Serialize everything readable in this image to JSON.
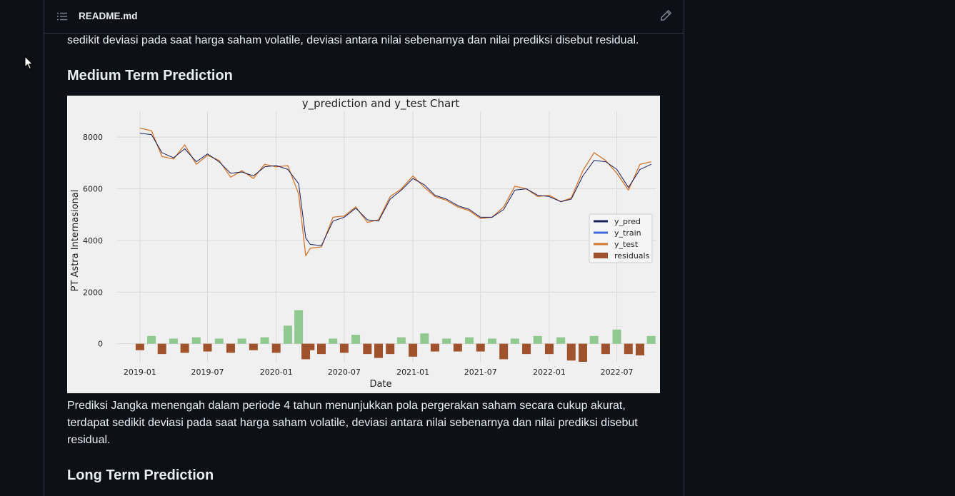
{
  "file": {
    "name": "README.md",
    "toc_icon": "list-unordered-icon",
    "edit_icon": "pencil-icon"
  },
  "content": {
    "top_paragraph": "sedikit deviasi pada saat harga saham volatile, deviasi antara nilai sebenarnya dan nilai prediksi disebut residual.",
    "medium_heading": "Medium Term Prediction",
    "bottom_paragraph": "Prediksi Jangka menengah dalam periode 4 tahun menunjukkan pola pergerakan saham secara cukup akurat, terdapat sedikit deviasi pada saat harga saham volatile, deviasi antara nilai sebenarnya dan nilai prediksi disebut residual.",
    "long_heading": "Long Term Prediction"
  },
  "colors": {
    "y_pred": "#1b1f5e",
    "y_train": "#4169e1",
    "y_test": "#d2772f",
    "residual_neg": "#a0522d",
    "residual_pos": "#8fc98f"
  },
  "chart_data": {
    "type": "line",
    "title": "y_prediction and y_test Chart",
    "xlabel": "Date",
    "ylabel": "PT Astra Internasional",
    "x_ticks": [
      "2019-01",
      "2019-07",
      "2020-01",
      "2020-07",
      "2021-01",
      "2021-07",
      "2022-01",
      "2022-07"
    ],
    "y_ticks": [
      0,
      2000,
      4000,
      6000,
      8000
    ],
    "ylim": [
      -700,
      9000
    ],
    "xlim": [
      "2018-11-01",
      "2022-10-15"
    ],
    "grid": true,
    "legend": {
      "placement": "center-right",
      "entries": [
        "y_pred",
        "y_train",
        "y_test",
        "residuals"
      ]
    },
    "series": [
      {
        "name": "y_test",
        "x": [
          "2019-01-01",
          "2019-02-01",
          "2019-03-01",
          "2019-04-01",
          "2019-05-01",
          "2019-06-01",
          "2019-07-01",
          "2019-08-01",
          "2019-09-01",
          "2019-10-01",
          "2019-11-01",
          "2019-12-01",
          "2020-01-01",
          "2020-02-01",
          "2020-03-01",
          "2020-03-20",
          "2020-04-01",
          "2020-05-01",
          "2020-06-01",
          "2020-07-01",
          "2020-08-01",
          "2020-09-01",
          "2020-10-01",
          "2020-11-01",
          "2020-12-01",
          "2021-01-01",
          "2021-02-01",
          "2021-03-01",
          "2021-04-01",
          "2021-05-01",
          "2021-06-01",
          "2021-07-01",
          "2021-08-01",
          "2021-09-01",
          "2021-10-01",
          "2021-11-01",
          "2021-12-01",
          "2022-01-01",
          "2022-02-01",
          "2022-03-01",
          "2022-04-01",
          "2022-05-01",
          "2022-06-01",
          "2022-07-01",
          "2022-08-01",
          "2022-09-01",
          "2022-10-01"
        ],
        "values": [
          8350,
          8250,
          7250,
          7150,
          7700,
          6950,
          7300,
          7100,
          6450,
          6700,
          6400,
          6950,
          6850,
          6900,
          5800,
          3400,
          3700,
          3750,
          4900,
          4950,
          5300,
          4700,
          4800,
          5700,
          6000,
          6500,
          6050,
          5700,
          5550,
          5300,
          5150,
          4850,
          4900,
          5300,
          6100,
          6000,
          5700,
          5750,
          5500,
          5650,
          6700,
          7400,
          7100,
          6600,
          5950,
          6950,
          7050
        ]
      },
      {
        "name": "y_pred",
        "x": [
          "2019-01-01",
          "2019-02-01",
          "2019-03-01",
          "2019-04-01",
          "2019-05-01",
          "2019-06-01",
          "2019-07-01",
          "2019-08-01",
          "2019-09-01",
          "2019-10-01",
          "2019-11-01",
          "2019-12-01",
          "2020-01-01",
          "2020-02-01",
          "2020-03-01",
          "2020-03-20",
          "2020-04-01",
          "2020-05-01",
          "2020-06-01",
          "2020-07-01",
          "2020-08-01",
          "2020-09-01",
          "2020-10-01",
          "2020-11-01",
          "2020-12-01",
          "2021-01-01",
          "2021-02-01",
          "2021-03-01",
          "2021-04-01",
          "2021-05-01",
          "2021-06-01",
          "2021-07-01",
          "2021-08-01",
          "2021-09-01",
          "2021-10-01",
          "2021-11-01",
          "2021-12-01",
          "2022-01-01",
          "2022-02-01",
          "2022-03-01",
          "2022-04-01",
          "2022-05-01",
          "2022-06-01",
          "2022-07-01",
          "2022-08-01",
          "2022-09-01",
          "2022-10-01"
        ],
        "values": [
          8150,
          8100,
          7400,
          7200,
          7550,
          7050,
          7350,
          7050,
          6600,
          6650,
          6500,
          6850,
          6900,
          6750,
          6200,
          4100,
          3850,
          3800,
          4750,
          4900,
          5250,
          4800,
          4750,
          5600,
          5950,
          6400,
          6150,
          5750,
          5600,
          5350,
          5200,
          4900,
          4900,
          5200,
          5950,
          6000,
          5750,
          5700,
          5500,
          5600,
          6500,
          7100,
          7050,
          6750,
          6050,
          6750,
          6950
        ]
      },
      {
        "name": "residuals",
        "x": [
          "2019-01-01",
          "2019-02-01",
          "2019-03-01",
          "2019-04-01",
          "2019-05-01",
          "2019-06-01",
          "2019-07-01",
          "2019-08-01",
          "2019-09-01",
          "2019-10-01",
          "2019-11-01",
          "2019-12-01",
          "2020-01-01",
          "2020-02-01",
          "2020-03-01",
          "2020-03-20",
          "2020-04-01",
          "2020-05-01",
          "2020-06-01",
          "2020-07-01",
          "2020-08-01",
          "2020-09-01",
          "2020-10-01",
          "2020-11-01",
          "2020-12-01",
          "2021-01-01",
          "2021-02-01",
          "2021-03-01",
          "2021-04-01",
          "2021-05-01",
          "2021-06-01",
          "2021-07-01",
          "2021-08-01",
          "2021-09-01",
          "2021-10-01",
          "2021-11-01",
          "2021-12-01",
          "2022-01-01",
          "2022-02-01",
          "2022-03-01",
          "2022-04-01",
          "2022-05-01",
          "2022-06-01",
          "2022-07-01",
          "2022-08-01",
          "2022-09-01",
          "2022-10-01"
        ],
        "values": [
          -250,
          300,
          -400,
          200,
          -350,
          250,
          -300,
          200,
          -350,
          200,
          -250,
          250,
          -350,
          700,
          1300,
          -600,
          -250,
          -400,
          200,
          -350,
          350,
          -400,
          -550,
          -400,
          250,
          -500,
          400,
          -300,
          200,
          -300,
          250,
          -300,
          200,
          -600,
          200,
          -400,
          300,
          -400,
          250,
          -650,
          -700,
          300,
          -400,
          550,
          -400,
          -450,
          300
        ]
      }
    ]
  }
}
